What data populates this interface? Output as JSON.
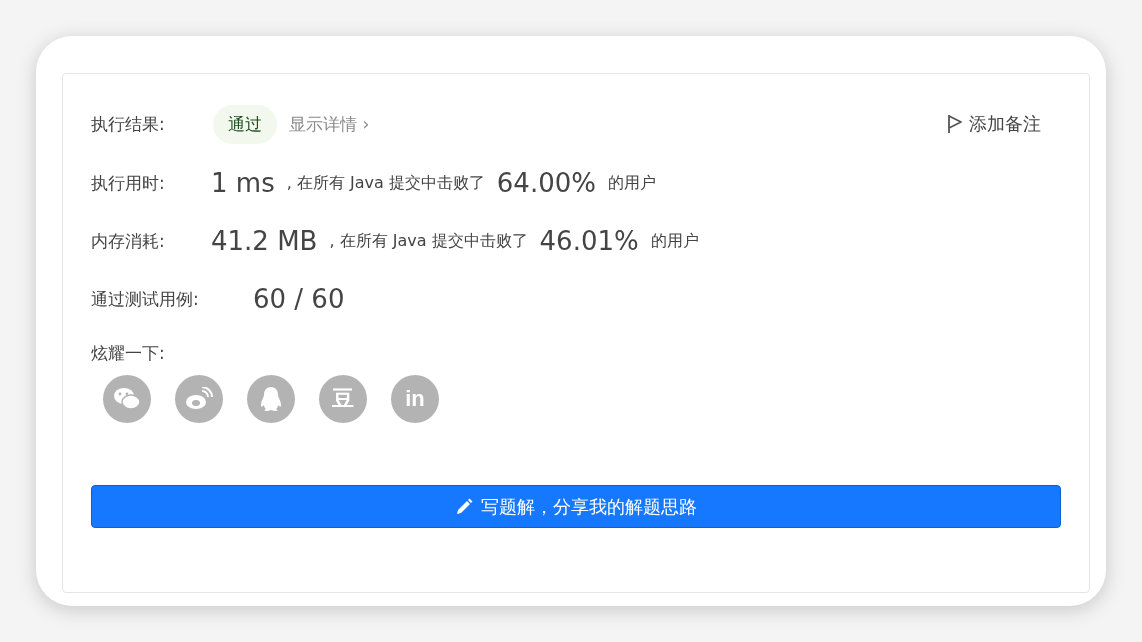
{
  "result": {
    "label": "执行结果:",
    "status": "通过",
    "details": "显示详情",
    "details_caret": "›",
    "note_button": "添加备注"
  },
  "stats": [
    {
      "label": "执行用时:",
      "value": "1 ms",
      "middle": ", 在所有 Java 提交中击败了",
      "percent": "64.00%",
      "suffix": "的用户"
    },
    {
      "label": "内存消耗:",
      "value": "41.2 MB",
      "middle": ", 在所有 Java 提交中击败了",
      "percent": "46.01%",
      "suffix": "的用户"
    }
  ],
  "cases": {
    "label": "通过测试用例:",
    "value": "60 / 60"
  },
  "share": {
    "label": "炫耀一下:",
    "items": [
      {
        "kind": "wechat"
      },
      {
        "kind": "weibo"
      },
      {
        "kind": "qq"
      },
      {
        "kind": "douban",
        "glyph": "豆"
      },
      {
        "kind": "linkedin",
        "glyph": "in"
      }
    ]
  },
  "solution_button": "写题解，分享我的解题思路"
}
